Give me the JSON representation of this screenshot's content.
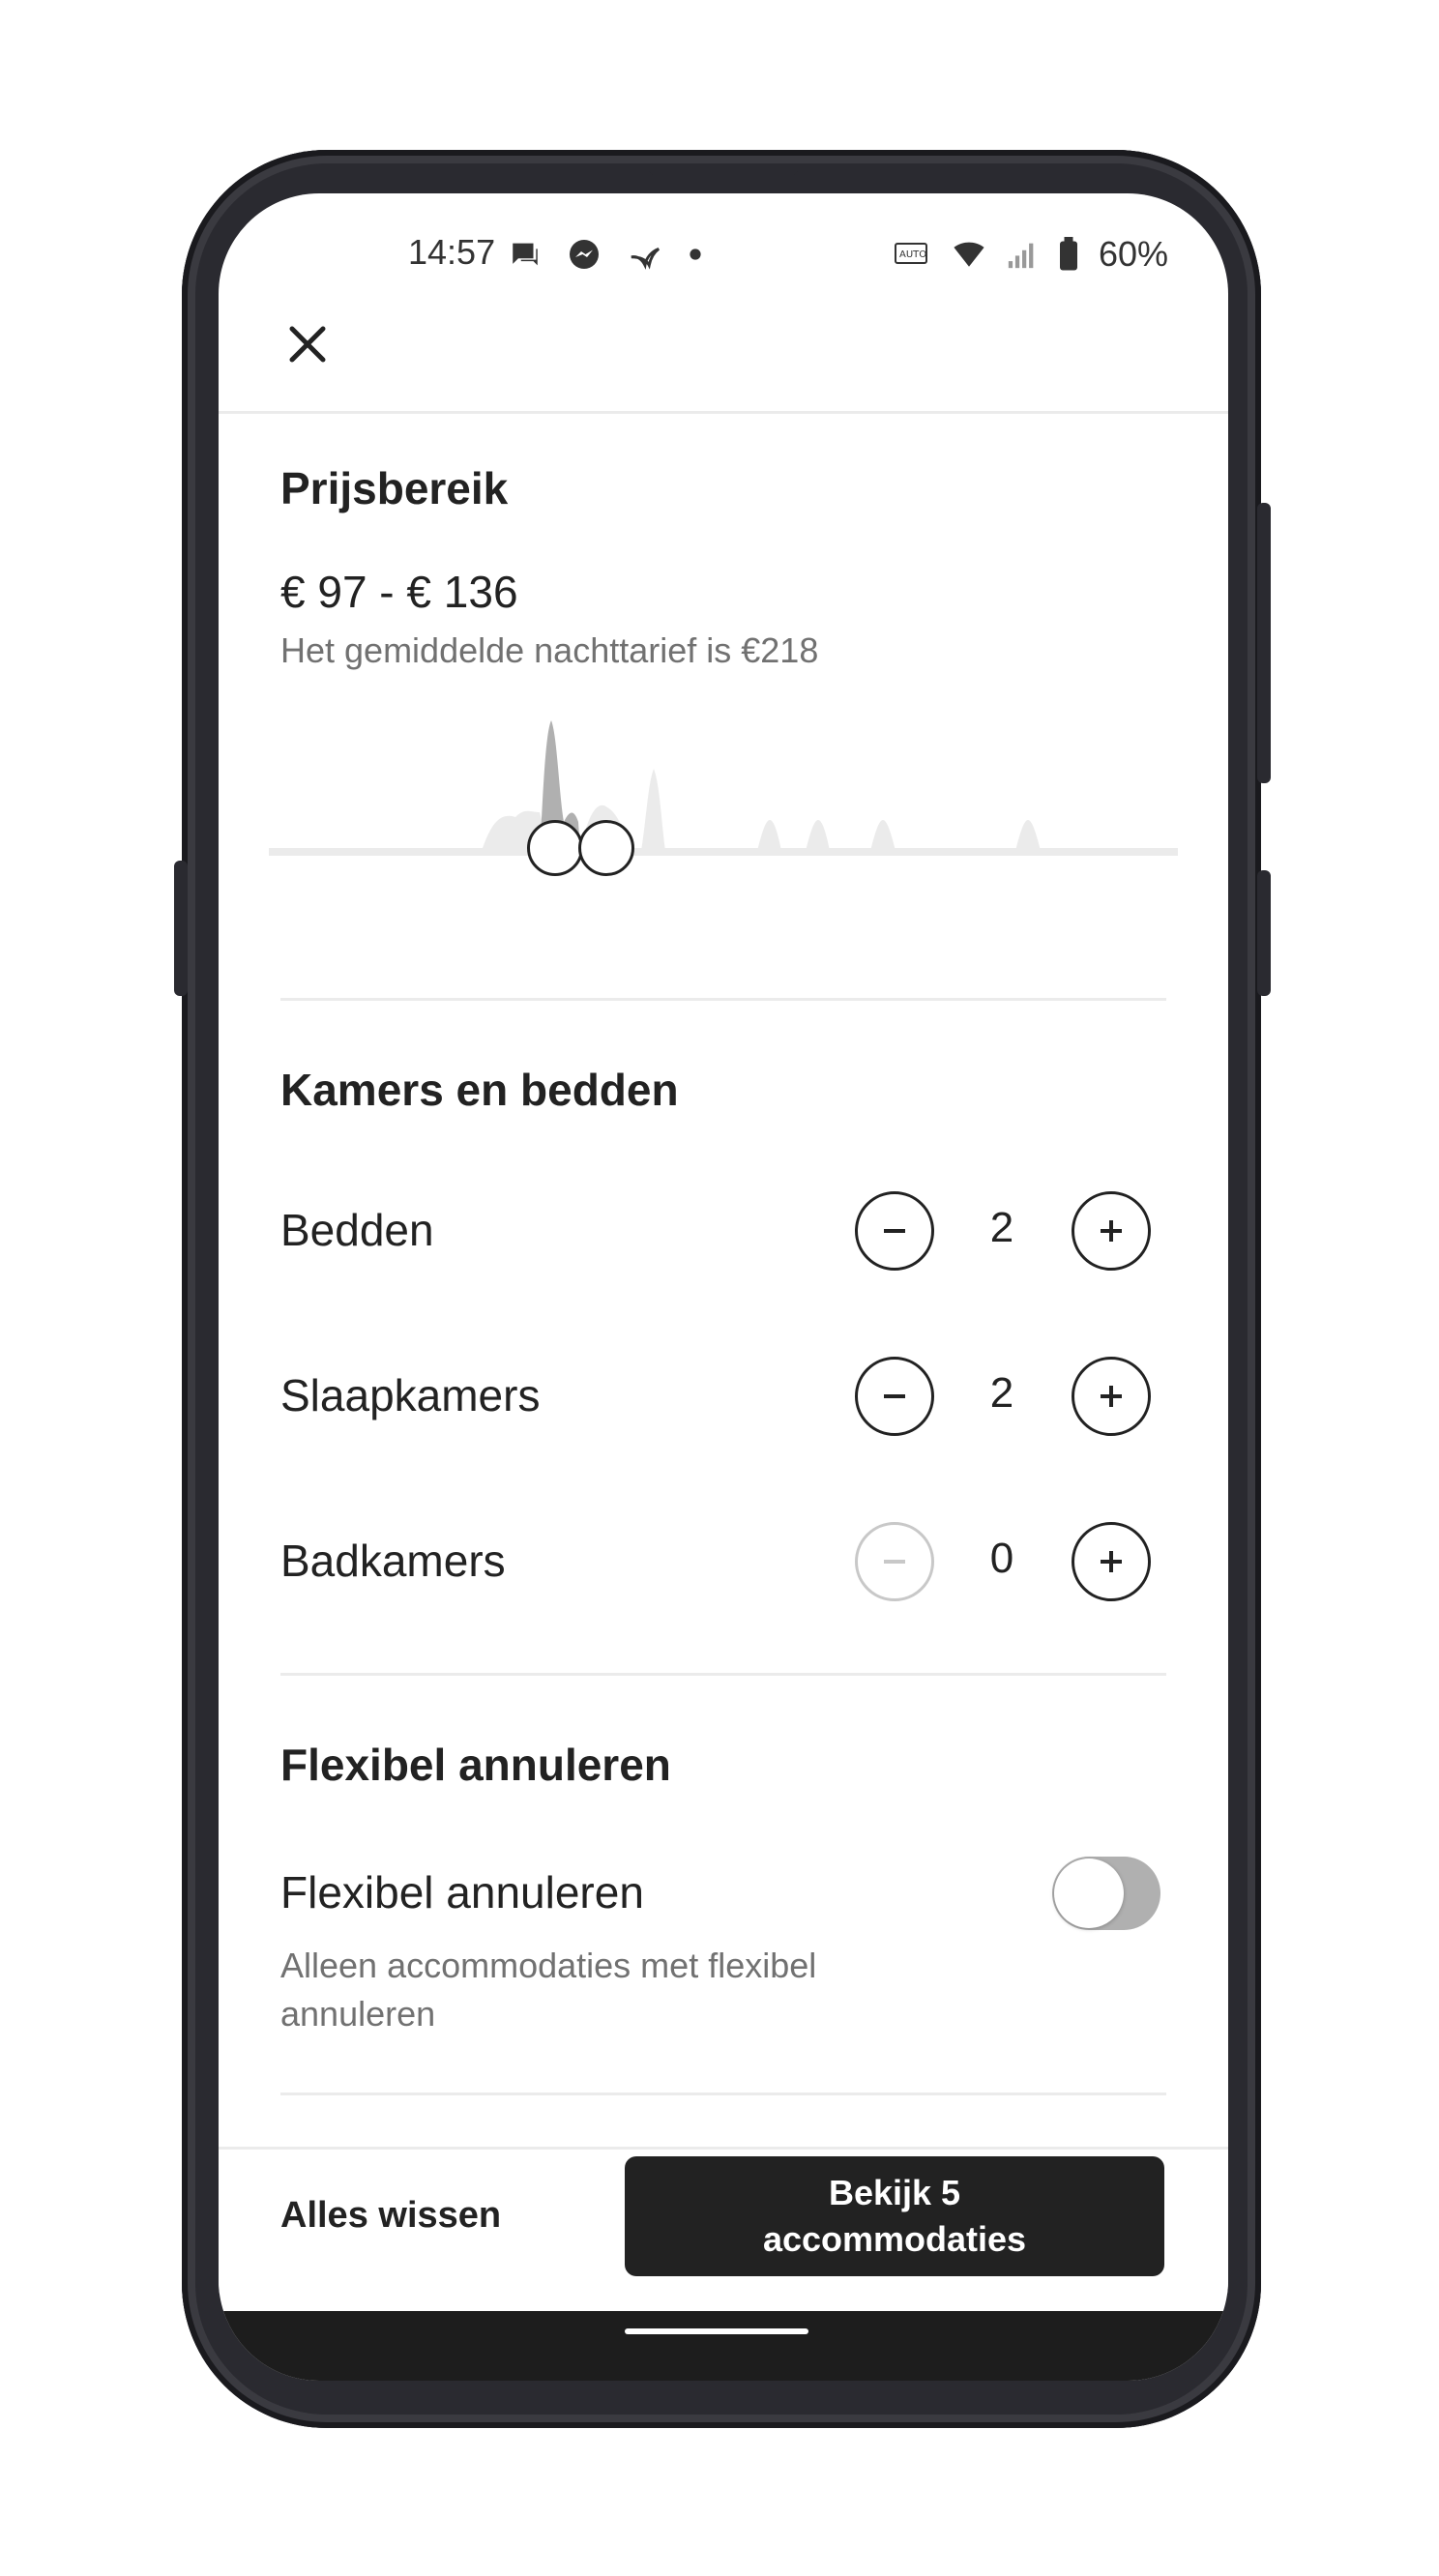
{
  "status_bar": {
    "time": "14:57",
    "battery": "60%",
    "left_icons": [
      "chat-notification-icon",
      "messenger-icon",
      "bird-app-icon",
      "dot-icon"
    ],
    "right_icons": [
      "auto-hd-icon",
      "wifi-icon",
      "signal-icon",
      "battery-icon"
    ]
  },
  "header": {
    "close_icon": "close-icon"
  },
  "price": {
    "title": "Prijsbereik",
    "range": "€ 97 - € 136",
    "subtitle": "Het gemiddelde nachttarief is €218"
  },
  "rooms": {
    "title": "Kamers en bedden",
    "rows": [
      {
        "label": "Bedden",
        "value": "2",
        "decrement_enabled": true
      },
      {
        "label": "Slaapkamers",
        "value": "2",
        "decrement_enabled": true
      },
      {
        "label": "Badkamers",
        "value": "0",
        "decrement_enabled": false
      }
    ]
  },
  "cancellation": {
    "title": "Flexibel annuleren",
    "toggle_label": "Flexibel annuleren",
    "toggle_description": "Alleen accommodaties met flexibel annuleren",
    "toggle_on": false
  },
  "footer": {
    "clear_label": "Alles wissen",
    "cta_label": "Bekijk 5 accommodaties"
  },
  "colors": {
    "primary_text": "#222222",
    "secondary_text": "#717171",
    "cta_background": "#222222",
    "divider": "#ebebeb"
  }
}
